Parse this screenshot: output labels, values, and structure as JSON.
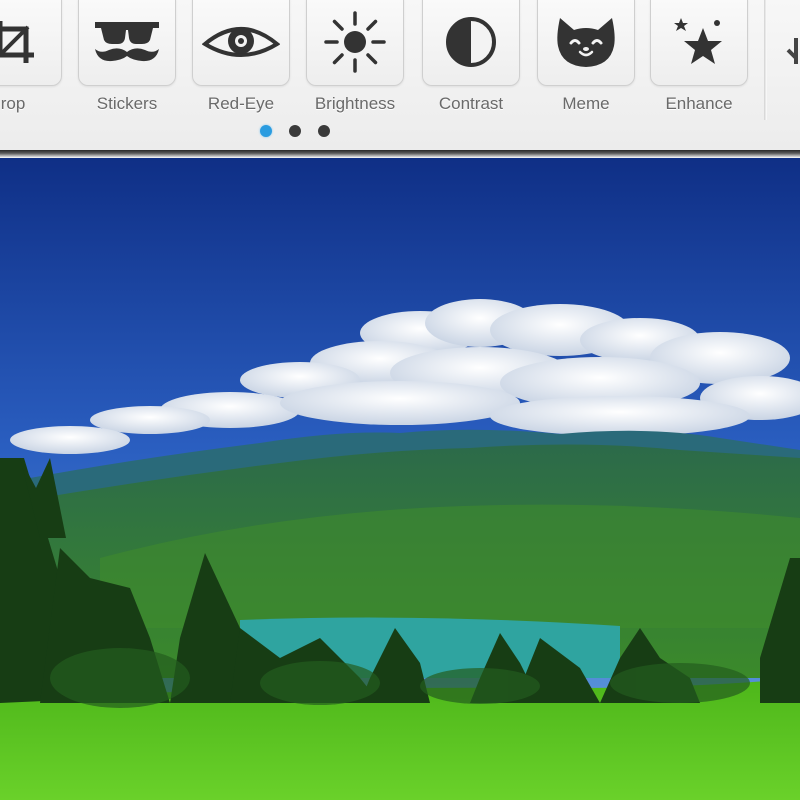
{
  "toolbar": {
    "tools": [
      {
        "label": "rop",
        "icon": "crop-icon"
      },
      {
        "label": "Stickers",
        "icon": "mustache-glasses-icon"
      },
      {
        "label": "Red-Eye",
        "icon": "eye-icon"
      },
      {
        "label": "Brightness",
        "icon": "sun-icon"
      },
      {
        "label": "Contrast",
        "icon": "contrast-icon"
      },
      {
        "label": "Meme",
        "icon": "cat-face-icon"
      },
      {
        "label": "Enhance",
        "icon": "magic-star-icon"
      }
    ],
    "next_icon": "crop-icon"
  },
  "pager": {
    "page_count": 3,
    "current_page": 1,
    "active_color": "#2a9ce0",
    "inactive_color": "#3a3a3a"
  },
  "photo": {
    "subject": "landscape-photo",
    "colors": {
      "sky_top": "#0f2f86",
      "sky_bottom": "#5f9fe0",
      "cloud": "#f4f6fa",
      "mountain": "#2d6e3e",
      "lake": "#2fa4a0",
      "grass": "#59c21e",
      "trees": "#173d14"
    }
  }
}
